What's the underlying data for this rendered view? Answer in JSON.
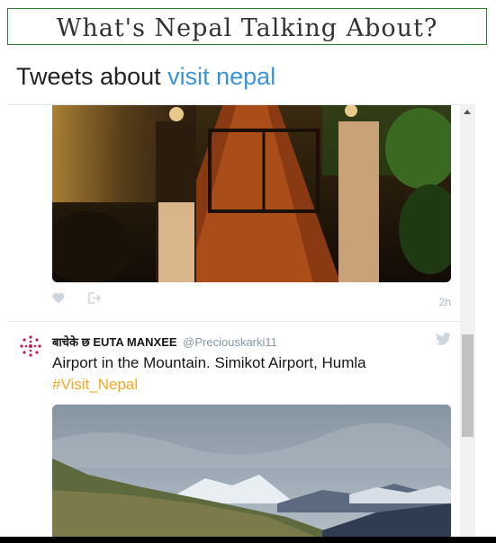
{
  "page": {
    "heading": "What's Nepal Talking About?"
  },
  "timeline": {
    "title_prefix": "Tweets about",
    "title_query": "visit nepal"
  },
  "tweets": [
    {
      "time": "2h"
    },
    {
      "display_name": "बाचेके छ EUTA MANXEE",
      "handle": "@Preciouskarki11",
      "text": "Airport in the Mountain. Simikot Airport, Humla",
      "hashtag": "#Visit_Nepal"
    }
  ],
  "colors": {
    "link": "#3b94d9",
    "hashtag": "#f5a623",
    "border": "#2e7d32"
  },
  "icons": [
    "heart-icon",
    "share-icon",
    "twitter-bird-icon",
    "avatar-icon",
    "scroll-up-arrow-icon"
  ]
}
